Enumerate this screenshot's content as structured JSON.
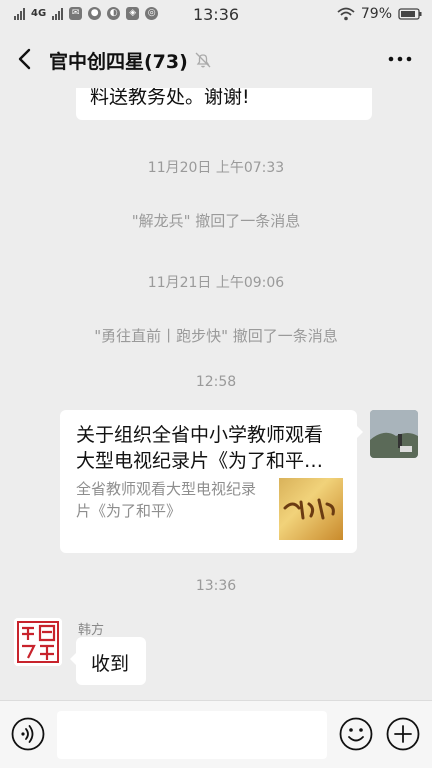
{
  "status_bar": {
    "network": "4G",
    "time": "13:36",
    "battery": "79%"
  },
  "header": {
    "title": "官中创四星(73)"
  },
  "messages": {
    "partial_bubble_text": "料送教务处。谢谢!",
    "time1": "11月20日 上午07:33",
    "recall1": "\"解龙兵\" 撤回了一条消息",
    "time2": "11月21日 上午09:06",
    "recall2": "\"勇往直前丨跑步快\" 撤回了一条消息",
    "time3": "12:58",
    "link_card": {
      "title_line1": "关于组织全省中小学教师观看",
      "title_line2": "大型电视纪录片《为了和平…",
      "desc": "全省教师观看大型电视纪录片《为了和平》"
    },
    "time4": "13:36",
    "sender_name": "韩方",
    "reply_text": "收到"
  },
  "icons": {
    "back": "back-arrow-icon",
    "mute": "bell-muted-icon",
    "more": "more-dots-icon",
    "voice": "voice-icon",
    "emoji": "emoji-icon",
    "plus": "plus-icon"
  },
  "colors": {
    "background": "#ededed",
    "bubble": "#ffffff",
    "system_text": "#9a9a9a"
  }
}
